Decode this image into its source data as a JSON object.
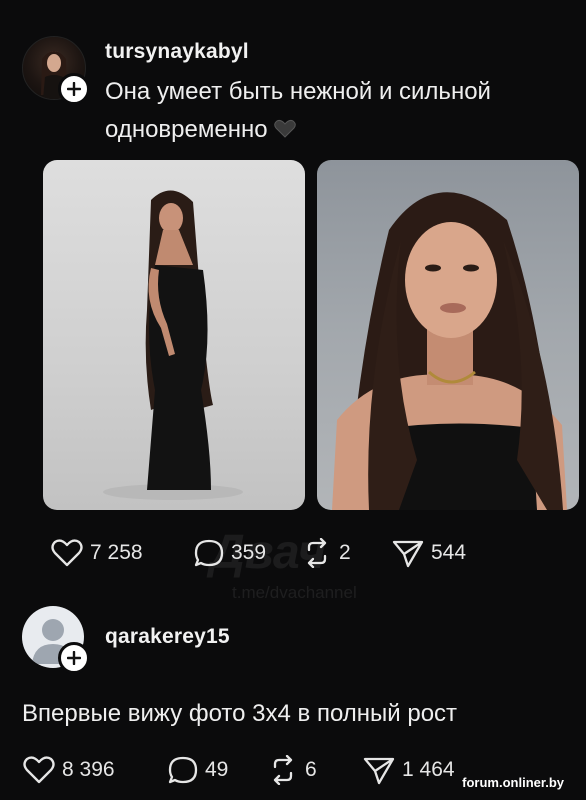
{
  "posts": [
    {
      "username": "tursynaykabyl",
      "caption_line1": "Она умеет быть нежной и сильной",
      "caption_line2": "одновременно",
      "caption_emoji": "🖤",
      "images": [
        {
          "alt": "full-length photo in black dress"
        },
        {
          "alt": "portrait photo with long dark hair"
        }
      ],
      "likes": "7 258",
      "replies": "359",
      "reposts": "2",
      "shares": "544"
    },
    {
      "username": "qarakerey15",
      "caption": "Впервые вижу фото 3х4 в полный рост",
      "likes": "8 396",
      "replies": "49",
      "reposts": "6",
      "shares": "1 464"
    }
  ],
  "watermark": {
    "title": "Двач",
    "subtitle": "t.me/dvachannel"
  },
  "site_watermark": "forum.onliner.by",
  "icons": [
    "plus-icon",
    "heart-icon",
    "comment-icon",
    "repost-icon",
    "share-icon",
    "user-placeholder-icon"
  ]
}
